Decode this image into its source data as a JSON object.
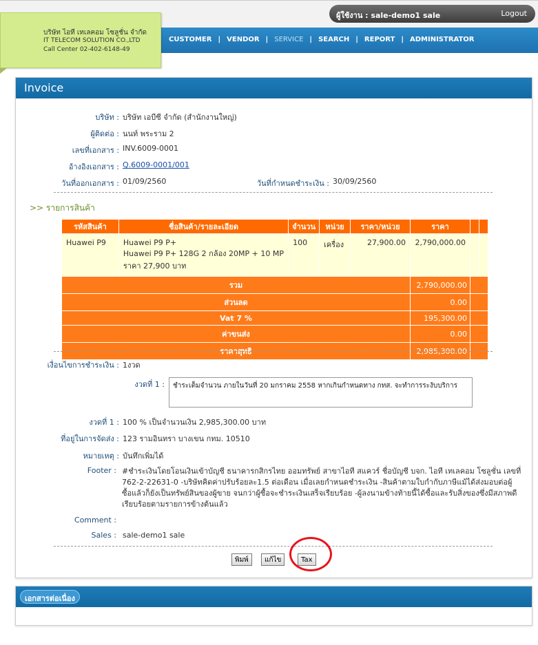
{
  "header": {
    "user_label": "ผู้ใช้งาน : sale-demo1 sale",
    "logout": "Logout"
  },
  "company": {
    "name_th": "บริษัท ไอที เทเลคอม โซลูชั่น จำกัด",
    "name_en": "IT TELECOM SOLUTION CO.,LTD",
    "call_center": "Call Center 02-402-6148-49"
  },
  "nav": {
    "items": [
      "CUSTOMER",
      "VENDOR",
      "SERVICE",
      "SEARCH",
      "REPORT",
      "ADMINISTRATOR"
    ],
    "active": "SERVICE"
  },
  "invoice": {
    "title": "Invoice",
    "company_label": "บริษัท :",
    "company_value": "บริษัท เอบีซี จำกัด (สำนักงานใหญ่)",
    "contact_label": "ผู้ติดต่อ :",
    "contact_value": "นนท์ พระราม 2",
    "docno_label": "เลขที่เอกสาร :",
    "docno_value": "INV.6009-0001",
    "ref_label": "อ้างอิงเอกสาร :",
    "ref_value": "Q.6009-0001/001",
    "issue_label": "วันที่ออกเอกสาร :",
    "issue_value": "01/09/2560",
    "due_label": "วันที่กำหนดชำระเงิน :",
    "due_value": "30/09/2560"
  },
  "items_section": {
    "title": ">> รายการสินค้า",
    "columns": [
      "รหัสสินค้า",
      "ชื่อสินค้า/รายละเอียด",
      "จำนวน",
      "หน่วย",
      "ราคา/หน่วย",
      "ราคา"
    ],
    "rows": [
      {
        "code": "Huawei P9",
        "desc_line1": "Huawei P9 P+",
        "desc_line2": "Huawei P9 P+ 128G 2 กล้อง 20MP + 10 MP",
        "desc_line3": "ราคา 27,900 บาท",
        "qty": "100",
        "unit": "เครื่อง",
        "unit_price": "27,900.00",
        "price": "2,790,000.00"
      }
    ],
    "summary": [
      {
        "label": "รวม",
        "value": "2,790,000.00"
      },
      {
        "label": "ส่วนลด",
        "value": "0.00"
      },
      {
        "label": "Vat 7 %",
        "value": "195,300.00"
      },
      {
        "label": "ค่าขนส่ง",
        "value": "0.00"
      },
      {
        "label": "ราคาสุทธิ",
        "value": "2,985,300.00"
      }
    ]
  },
  "payment": {
    "terms_label": "เงื่อนไขการชำระเงิน :",
    "terms_value": "1งวด",
    "installment_label": "งวดที่ 1 :",
    "installment_text": "ชำระเต็มจำนวน ภายในวันที่ 20 มกราคม 2558 หากเกินกำหนดทาง กทส. จะทำการระงับบริการ",
    "installment_summary_label": "งวดที่ 1 :",
    "installment_summary_value": "100 % เป็นจำนวนเงิน 2,985,300.00 บาท",
    "address_label": "ที่อยู่ในการจัดส่ง :",
    "address_value": "123 รามอินทรา บางเขน กทม. 10510",
    "note_label": "หมายเหตุ :",
    "note_value": "บันทึกเพิ่มได้",
    "footer_label": "Footer :",
    "footer_value": "#ชำระเงินโดยโอนเงินเข้าบัญชี ธนาคารกสิกรไทย ออมทรัพย์ สาขาไอที สแควร์ ชื่อบัญชี บจก. ไอที เทเลคอม โซลูชั่น เลขที่ 762-2-22631-0 -บริษัทคิดค่าปรับร้อยละ1.5 ต่อเดือน เมื่อเลยกำหนดชำระเงิน -สินค้าตามใบกำกับภาษีแม้ได้ส่งมอบต่อผู้ซื้อแล้วก็ยังเป็นทรัพย์สินของผู้ขาย จนกว่าผู้ซื้อจะชำระเงินเสร็จเรียบร้อย -ผู้ลงนามข้างท้ายนี้ได้ซื้อและรับสิ่งของซึ่งมีสภาพดีเรียบร้อยตามรายการข้างต้นแล้ว",
    "comment_label": "Comment :",
    "comment_value": "",
    "sales_label": "Sales :",
    "sales_value": "sale-demo1 sale"
  },
  "buttons": {
    "print": "พิมพ์",
    "edit": "แก้ไข",
    "tax": "Tax"
  },
  "related": {
    "title": "เอกสารต่อเนื่อง"
  },
  "colors": {
    "nav_blue": "#2c8bc9",
    "orange": "#ff6a00",
    "logo_green": "#d5ec8e",
    "highlight_red": "#e8141b"
  }
}
